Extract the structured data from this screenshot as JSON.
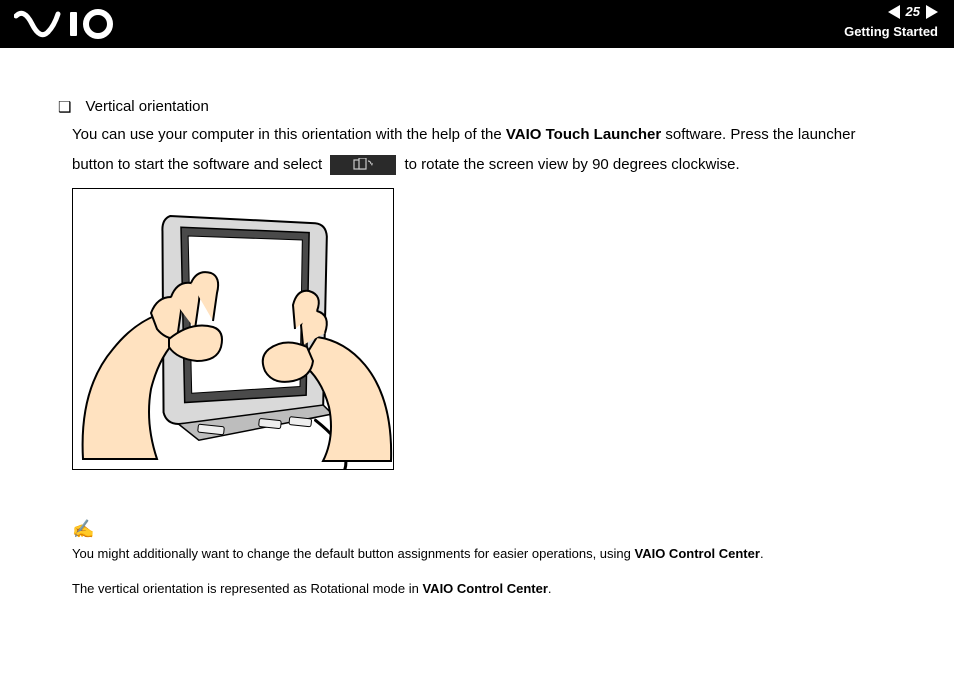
{
  "header": {
    "page_number": "25",
    "section": "Getting Started"
  },
  "body": {
    "bullet_title": "Vertical orientation",
    "line1_a": "You can use your computer in this orientation with the help of the ",
    "line1_bold": "VAIO Touch Launcher",
    "line1_b": " software. Press the launcher",
    "line2_a": "button to start the software and select ",
    "line2_b": " to rotate the screen view by 90 degrees clockwise."
  },
  "notes": {
    "note1_a": "You might additionally want to change the default button assignments for easier operations, using ",
    "note1_bold": "VAIO Control Center",
    "note1_b": ".",
    "note2_a": "The vertical orientation is represented as Rotational mode in ",
    "note2_bold": "VAIO Control Center",
    "note2_b": "."
  }
}
